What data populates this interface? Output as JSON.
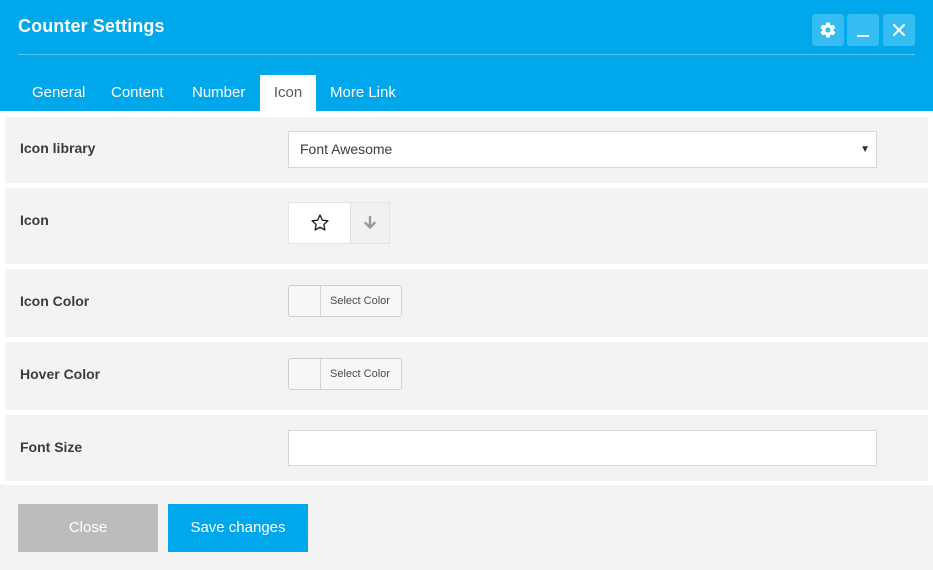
{
  "window": {
    "title": "Counter Settings"
  },
  "header_controls": {
    "settings": "gear-icon",
    "minimize": "minimize-icon",
    "close": "close-icon"
  },
  "tabs": [
    {
      "label": "General",
      "active": false
    },
    {
      "label": "Content",
      "active": false
    },
    {
      "label": "Number",
      "active": false
    },
    {
      "label": "Icon",
      "active": true
    },
    {
      "label": "More Link",
      "active": false
    }
  ],
  "fields": {
    "icon_library": {
      "label": "Icon library",
      "value": "Font Awesome"
    },
    "icon": {
      "label": "Icon",
      "preview_icon": "star-outline-icon",
      "toggle_icon": "arrow-down-icon"
    },
    "icon_color": {
      "label": "Icon Color",
      "button_label": "Select Color"
    },
    "hover_color": {
      "label": "Hover Color",
      "button_label": "Select Color"
    },
    "font_size": {
      "label": "Font Size",
      "value": ""
    }
  },
  "footer": {
    "close_label": "Close",
    "save_label": "Save changes"
  },
  "colors": {
    "accent": "#00a7ea",
    "row_background": "#f3f3f3",
    "close_button": "#bcbcbc"
  }
}
